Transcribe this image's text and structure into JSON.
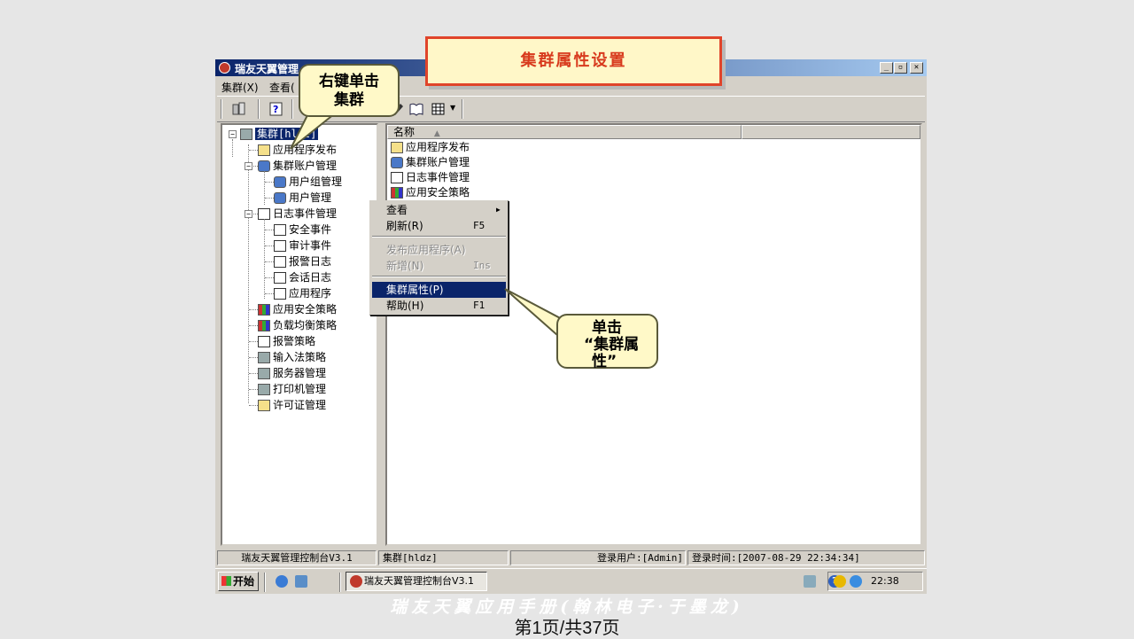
{
  "window": {
    "title": "瑞友天翼管理",
    "controls": [
      "_",
      "▫",
      "✕"
    ]
  },
  "menubar": {
    "items": [
      "集群(X)",
      "查看("
    ]
  },
  "tree": {
    "root": "集群[hldz]",
    "items": [
      {
        "label": "应用程序发布",
        "icon": "folder-icon"
      },
      {
        "label": "集群账户管理",
        "icon": "users-icon"
      },
      {
        "label": "用户组管理",
        "icon": "user-group-icon"
      },
      {
        "label": "用户管理",
        "icon": "user-icon"
      },
      {
        "label": "日志事件管理",
        "icon": "log-icon"
      },
      {
        "label": "安全事件",
        "icon": "log-icon"
      },
      {
        "label": "审计事件",
        "icon": "log-icon"
      },
      {
        "label": "报警日志",
        "icon": "log-icon"
      },
      {
        "label": "会话日志",
        "icon": "log-icon"
      },
      {
        "label": "应用程序",
        "icon": "log-icon"
      },
      {
        "label": "应用安全策略",
        "icon": "policy-icon"
      },
      {
        "label": "负载均衡策略",
        "icon": "balance-icon"
      },
      {
        "label": "报警策略",
        "icon": "alarm-icon"
      },
      {
        "label": "输入法策略",
        "icon": "keyboard-icon"
      },
      {
        "label": "服务器管理",
        "icon": "server-icon"
      },
      {
        "label": "打印机管理",
        "icon": "printer-icon"
      },
      {
        "label": "许可证管理",
        "icon": "license-icon"
      }
    ]
  },
  "list": {
    "column_name": "名称",
    "rows": [
      "应用程序发布",
      "集群账户管理",
      "日志事件管理",
      "应用安全策略"
    ]
  },
  "context_menu": {
    "items": [
      {
        "label": "查看",
        "shortcut": "",
        "submenu": true,
        "disabled": false
      },
      {
        "label": "刷新(R)",
        "shortcut": "F5",
        "disabled": false
      },
      {
        "label": "发布应用程序(A)",
        "shortcut": "",
        "disabled": true
      },
      {
        "label": "新增(N)",
        "shortcut": "Ins",
        "disabled": true
      },
      {
        "label": "集群属性(P)",
        "shortcut": "",
        "disabled": false,
        "highlighted": true
      },
      {
        "label": "帮助(H)",
        "shortcut": "F1",
        "disabled": false
      }
    ]
  },
  "statusbar": {
    "app": "瑞友天翼管理控制台V3.1",
    "cluster": "集群[hldz]",
    "user": "登录用户:[Admin]",
    "login_time": "登录时间:[2007-08-29 22:34:34]"
  },
  "taskbar": {
    "start": "开始",
    "task": "瑞友天翼管理控制台V3.1",
    "clock": "22:38"
  },
  "banner": "集群属性设置",
  "callout_right_click": "右键单击\n集群",
  "callout_click_line1": "单击",
  "callout_click_line2": "“集群属",
  "callout_click_line3": "性”",
  "caption_line1": "瑞友天翼应用手册(翰林电子·于墨龙)",
  "caption_line2": "第1页/共37页",
  "colors": {
    "title_bar": "#0a246a",
    "highlight": "#0a246a",
    "banner_border": "#e0442a",
    "banner_text": "#d83b1e",
    "callout_bg": "#fff9c8"
  }
}
